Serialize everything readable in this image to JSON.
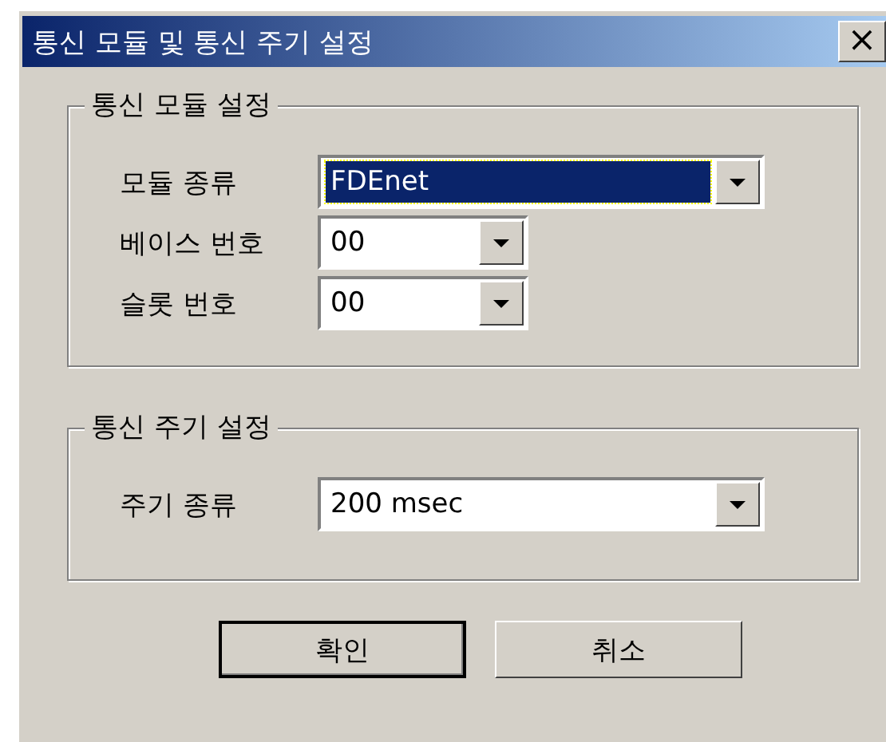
{
  "window": {
    "title": "통신 모듈 및 통신 주기 설정",
    "close": "×"
  },
  "groups": [
    {
      "title": "통신 모듈 설정",
      "fields": [
        {
          "label": "모듈 종류",
          "value": "FDEnet",
          "focused": true,
          "wide": true
        },
        {
          "label": "베이스 번호",
          "value": "00",
          "focused": false,
          "wide": false
        },
        {
          "label": "슬롯 번호",
          "value": "00",
          "focused": false,
          "wide": false
        }
      ]
    },
    {
      "title": "통신 주기 설정",
      "fields": [
        {
          "label": "주기 종류",
          "value": "200 msec",
          "focused": false,
          "wide": true
        }
      ]
    }
  ],
  "buttons": [
    {
      "label": "확인",
      "default": true
    },
    {
      "label": "취소",
      "default": false
    }
  ]
}
